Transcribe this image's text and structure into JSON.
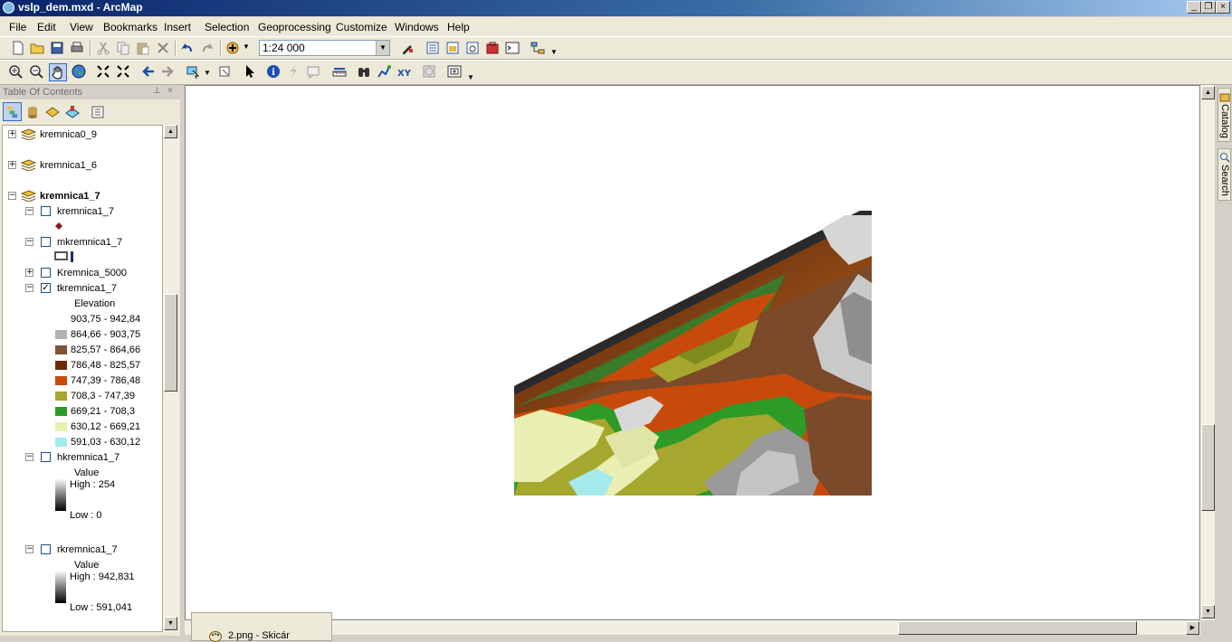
{
  "window": {
    "title": "vslp_dem.mxd - ArcMap"
  },
  "menu": [
    "File",
    "Edit",
    "View",
    "Bookmarks",
    "Insert",
    "Selection",
    "Geoprocessing",
    "Customize",
    "Windows",
    "Help"
  ],
  "toolbar": {
    "scale_value": "1:24 000"
  },
  "toc": {
    "title": "Table Of Contents",
    "groups": [
      {
        "label": "kremnica0_9"
      },
      {
        "label": "kremnica1_6"
      },
      {
        "label": "kremnica1_7"
      }
    ],
    "layers": {
      "kremnica1_7": {
        "label": "kremnica1_7"
      },
      "mkremnica1_7": {
        "label": "mkremnica1_7"
      },
      "Kremnica_5000": {
        "label": "Kremnica_5000"
      },
      "tkremnica1_7": {
        "label": "tkremnica1_7",
        "field": "Elevation"
      },
      "hkremnica1_7": {
        "label": "hkremnica1_7",
        "field": "Value",
        "high": "High : 254",
        "low": "Low : 0"
      },
      "rkremnica1_7": {
        "label": "rkremnica1_7",
        "field": "Value",
        "high": "High : 942,831",
        "low": "Low : 591,041"
      }
    },
    "elevation_classes": [
      {
        "label": "903,75 - 942,84",
        "color": "#ffffff"
      },
      {
        "label": "864,66 - 903,75",
        "color": "#b2b2b2"
      },
      {
        "label": "825,57 - 864,66",
        "color": "#7f5334"
      },
      {
        "label": "786,48 - 825,57",
        "color": "#6e2907"
      },
      {
        "label": "747,39 - 786,48",
        "color": "#c84a0a"
      },
      {
        "label": "708,3 - 747,39",
        "color": "#a6a72e"
      },
      {
        "label": "669,21 - 708,3",
        "color": "#2e9a28"
      },
      {
        "label": "630,12 - 669,21",
        "color": "#e9efb0"
      },
      {
        "label": "591,03 - 630,12",
        "color": "#a4eaea"
      }
    ]
  },
  "side_tabs": {
    "catalog": "Catalog",
    "search": "Search"
  },
  "taskbar": {
    "item": "2.png - Skicár"
  }
}
